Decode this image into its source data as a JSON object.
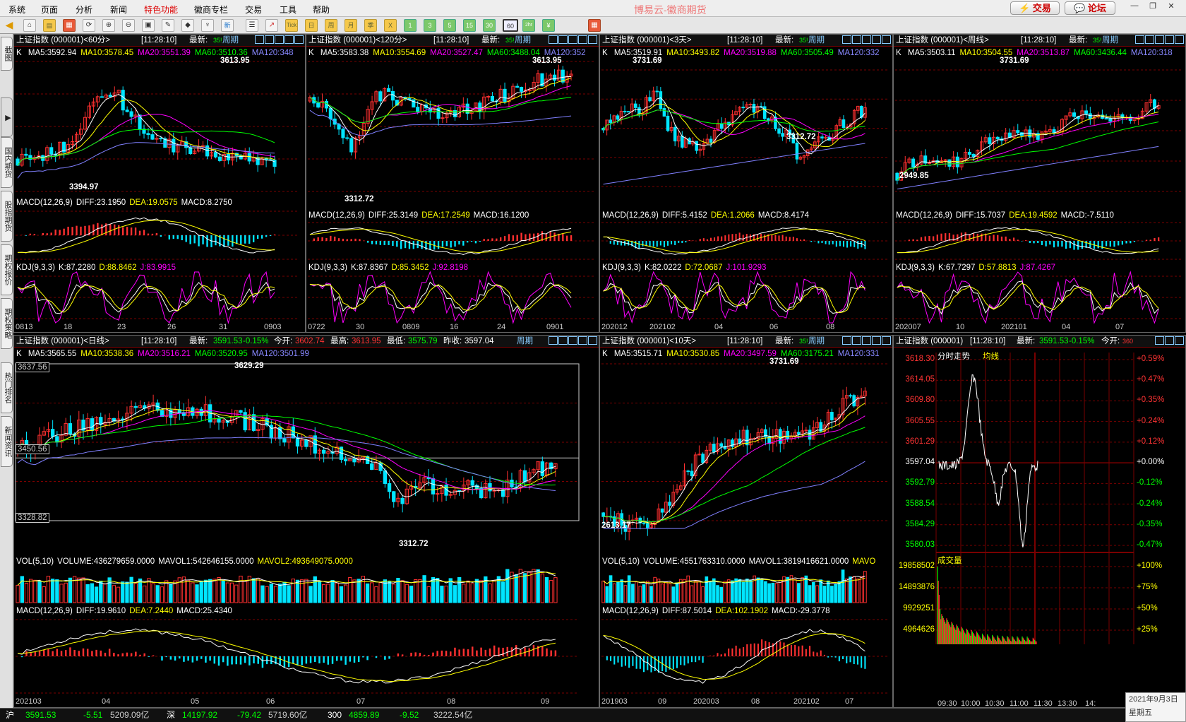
{
  "menu": [
    "系统",
    "页面",
    "分析",
    "新闻",
    "特色功能",
    "徽商专栏",
    "交易",
    "工具",
    "帮助"
  ],
  "menu_special_index": 4,
  "app_title": "博易云-徽商期货",
  "trade_btn": "交易",
  "forum_btn": "论坛",
  "toolbar_letters": [
    "日",
    "周",
    "月",
    "季",
    "X",
    "1",
    "3",
    "5",
    "15",
    "30",
    "60",
    "2hr",
    "¥"
  ],
  "side_tabs": [
    "截图",
    "国内期货",
    "股指期货",
    "期权报价",
    "期权策略",
    "热门排名",
    "新闻资讯"
  ],
  "common": {
    "time": "[11:28:10]",
    "latest_label": "最新:",
    "latest_short": "35!",
    "period_btn": "周期"
  },
  "panels": {
    "p60": {
      "title": "上证指数 (000001)<60分>",
      "ma_k": "K",
      "ma": [
        "MA5:3592.94",
        "MA10:3578.45",
        "MA20:3551.39",
        "MA60:3510.36",
        "MA120:348"
      ],
      "high_label": "3613.95",
      "low_label": "3394.97",
      "macd": [
        "MACD(12,26,9)",
        "DIFF:23.1950",
        "DEA:19.0575",
        "MACD:8.2750"
      ],
      "kdj": [
        "KDJ(9,3,3)",
        "K:87.2280",
        "D:88.8462",
        "J:83.9915"
      ],
      "xticks": [
        "0813",
        "18",
        "23",
        "26",
        "31",
        "0903"
      ]
    },
    "p120": {
      "title": "上证指数 (000001)<120分>",
      "ma_k": "K",
      "ma": [
        "MA5:3583.38",
        "MA10:3554.69",
        "MA20:3527.47",
        "MA60:3488.04",
        "MA120:352"
      ],
      "high_label": "3613.95",
      "low_label": "3312.72",
      "macd": [
        "MACD(12,26,9)",
        "DIFF:25.3149",
        "DEA:17.2549",
        "MACD:16.1200"
      ],
      "kdj": [
        "KDJ(9,3,3)",
        "K:87.8367",
        "D:85.3452",
        "J:92.8198"
      ],
      "xticks": [
        "0722",
        "30",
        "0809",
        "16",
        "24",
        "0901"
      ]
    },
    "p3d": {
      "title": "上证指数 (000001)<3天>",
      "ma_k": "K",
      "ma": [
        "MA5:3519.91",
        "MA10:3493.82",
        "MA20:3519.88",
        "MA60:3505.49",
        "MA120:332"
      ],
      "high_label": "3731.69",
      "low_label": "3312.72",
      "macd": [
        "MACD(12,26,9)",
        "DIFF:5.4152",
        "DEA:1.2066",
        "MACD:8.4174"
      ],
      "kdj": [
        "KDJ(9,3,3)",
        "K:82.0222",
        "D:72.0687",
        "J:101.9293"
      ],
      "xticks": [
        "202012",
        "202102",
        "04",
        "06",
        "08"
      ]
    },
    "pwk": {
      "title": "上证指数 (000001)<周线>",
      "ma_k": "K",
      "ma": [
        "MA5:3503.11",
        "MA10:3504.55",
        "MA20:3513.87",
        "MA60:3436.44",
        "MA120:318"
      ],
      "high_label": "3731.69",
      "low_label": "2949.85",
      "macd": [
        "MACD(12,26,9)",
        "DIFF:15.7037",
        "DEA:19.4592",
        "MACD:-7.5110"
      ],
      "kdj": [
        "KDJ(9,3,3)",
        "K:67.7297",
        "D:57.8813",
        "J:87.4267"
      ],
      "xticks": [
        "202007",
        "10",
        "202101",
        "04",
        "07"
      ]
    },
    "pday": {
      "title": "上证指数 (000001)<日线>",
      "latest": "3591.53",
      "chg": "-0.15%",
      "open_label": "今开:",
      "open": "3602.74",
      "high_label2": "最高:",
      "high": "3613.95",
      "low_label2": "最低:",
      "low": "3575.79",
      "prev_label": "昨收:",
      "prev": "3597.04",
      "ma_k": "K",
      "ma": [
        "MA5:3565.55",
        "MA10:3538.36",
        "MA20:3516.21",
        "MA60:3520.95",
        "MA120:3501.99"
      ],
      "high_label": "3629.29",
      "low_label": "3312.72",
      "ylabels": [
        "3637.56",
        "3450.56",
        "3328.82"
      ],
      "vol": [
        "VOL(5,10)",
        "VOLUME:436279659.0000",
        "MAVOL1:542646155.0000",
        "MAVOL2:493649075.0000"
      ],
      "macd": [
        "MACD(12,26,9)",
        "DIFF:19.9610",
        "DEA:7.2440",
        "MACD:25.4340"
      ],
      "xticks": [
        "202103",
        "04",
        "05",
        "06",
        "07",
        "08",
        "09"
      ]
    },
    "p10d": {
      "title": "上证指数 (000001)<10天>",
      "ma_k": "K",
      "ma": [
        "MA5:3515.71",
        "MA10:3530.85",
        "MA20:3497.59",
        "MA60:3175.21",
        "MA120:331"
      ],
      "high_label": "3731.69",
      "low_label": "2613.17",
      "vol": [
        "VOL(5,10)",
        "VOLUME:4551763310.0000",
        "MAVOL1:3819416621.0000",
        "MAVO"
      ],
      "macd": [
        "MACD(12,26,9)",
        "DIFF:87.5014",
        "DEA:102.1902",
        "MACD:-29.3778"
      ],
      "xticks": [
        "201903",
        "09",
        "202003",
        "08",
        "202102",
        "07"
      ]
    },
    "ptick": {
      "title": "上证指数 (000001)",
      "latest": "3591.53",
      "chg": "-0.15%",
      "open_label": "今开:",
      "open_short": "360",
      "tabs": [
        "分时走势",
        "均线"
      ],
      "prices": [
        "3618.30",
        "3614.05",
        "3609.80",
        "3605.55",
        "3601.29",
        "3597.04",
        "3592.79",
        "3588.54",
        "3584.29",
        "3580.03"
      ],
      "pcts": [
        "+0.59%",
        "+0.47%",
        "+0.35%",
        "+0.24%",
        "+0.12%",
        "+0.00%",
        "-0.12%",
        "-0.24%",
        "-0.35%",
        "-0.47%"
      ],
      "vol_title": "成交量",
      "vols": [
        "19858502",
        "14893876",
        "9929251",
        "4964626"
      ],
      "vol_pcts": [
        "+100%",
        "+75%",
        "+50%",
        "+25%"
      ],
      "times": [
        "09:30",
        "10:00",
        "10:30",
        "11:00",
        "11:30",
        "13:30",
        "14:"
      ]
    }
  },
  "statusbar": {
    "sh_label": "沪",
    "sh_val": "3591.53",
    "sh_chg": "-5.51",
    "sh_amt": "5209.09亿",
    "sz_label": "深",
    "sz_val": "14197.92",
    "sz_chg": "-79.42",
    "sz_amt": "5719.60亿",
    "c300_label": "300",
    "c300_val": "4859.89",
    "c300_chg": "-9.52",
    "c300_amt": "3222.54亿"
  },
  "clock": {
    "date": "2021年9月3日",
    "weekday": "星期五"
  },
  "colors": {
    "up": "#ff3030",
    "down": "#00e5ff",
    "ma5": "#ffffff",
    "ma10": "#ffff00",
    "ma20": "#ff00ff",
    "ma60": "#00ff00",
    "ma120": "#8080ff",
    "grid": "#7a0000"
  }
}
